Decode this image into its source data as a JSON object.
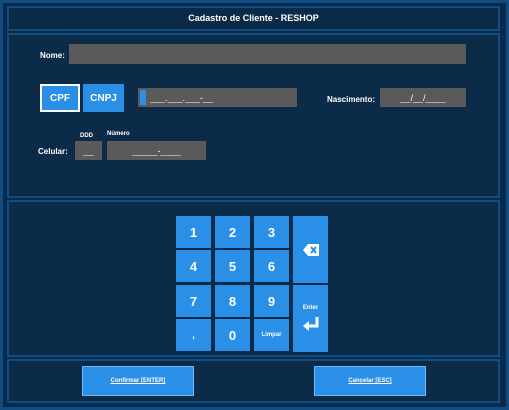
{
  "window": {
    "title": "Cadastro de Cliente - RESHOP"
  },
  "form": {
    "name_label": "Nome:",
    "name_value": "",
    "cpf_label": "CPF",
    "cnpj_label": "CNPJ",
    "document_value": "___.___.___-__",
    "birth_label": "Nascimento:",
    "birth_value": "__/__/____",
    "ddd_label": "DDD",
    "number_label": "Número",
    "phone_label": "Celular:",
    "ddd_value": "__",
    "phone_value": "_____-____"
  },
  "keypad": {
    "keys": [
      "1",
      "2",
      "3",
      "4",
      "5",
      "6",
      "7",
      "8",
      "9",
      ",",
      "0"
    ],
    "clear_label": "Limpar",
    "enter_label": "Enter",
    "backspace_icon": "backspace-icon",
    "enter_icon": "enter-return-icon"
  },
  "footer": {
    "confirm_label": "Confirmar [ENTER]",
    "cancel_label": "Cancelar [ESC]"
  },
  "colors": {
    "background": "#0b2a47",
    "border": "#0e4d86",
    "accent": "#2a8fe6",
    "field": "#5a5a5a"
  }
}
